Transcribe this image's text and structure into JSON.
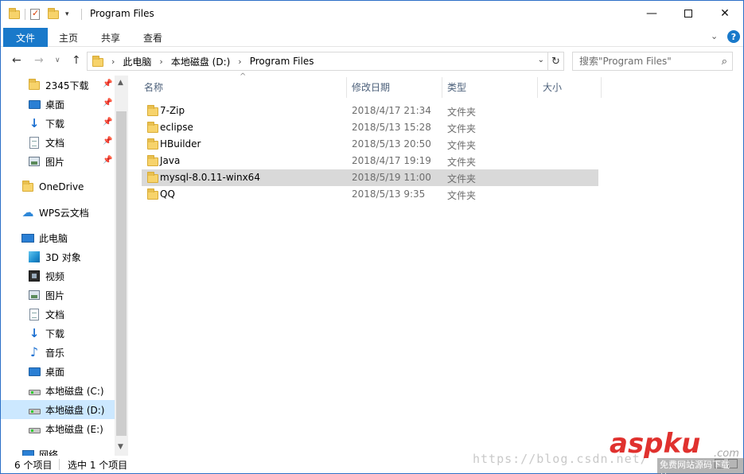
{
  "window": {
    "title": "Program Files",
    "controls": {
      "minimize": "—",
      "maximize": "",
      "close": "✕"
    }
  },
  "ribbon": {
    "tabs": [
      "文件",
      "主页",
      "共享",
      "查看"
    ],
    "help": "?"
  },
  "address": {
    "crumbs": [
      "此电脑",
      "本地磁盘 (D:)",
      "Program Files"
    ],
    "search_placeholder": "搜索\"Program Files\""
  },
  "nav_pane": {
    "items": [
      {
        "label": "2345下载",
        "icon": "folder-icon",
        "pinned": true
      },
      {
        "label": "桌面",
        "icon": "desktop-icon",
        "pinned": true
      },
      {
        "label": "下载",
        "icon": "download-icon",
        "pinned": true
      },
      {
        "label": "文档",
        "icon": "document-icon",
        "pinned": true
      },
      {
        "label": "图片",
        "icon": "pictures-icon",
        "pinned": true
      },
      {
        "label": "OneDrive",
        "icon": "folder-icon"
      },
      {
        "label": "WPS云文档",
        "icon": "cloud-icon"
      },
      {
        "label": "此电脑",
        "icon": "computer-icon"
      },
      {
        "label": "3D 对象",
        "icon": "3d-objects-icon"
      },
      {
        "label": "视频",
        "icon": "videos-icon"
      },
      {
        "label": "图片",
        "icon": "pictures-icon"
      },
      {
        "label": "文档",
        "icon": "document-icon"
      },
      {
        "label": "下载",
        "icon": "download-icon"
      },
      {
        "label": "音乐",
        "icon": "music-icon"
      },
      {
        "label": "桌面",
        "icon": "desktop-icon"
      },
      {
        "label": "本地磁盘 (C:)",
        "icon": "drive-icon"
      },
      {
        "label": "本地磁盘 (D:)",
        "icon": "drive-icon",
        "selected": true
      },
      {
        "label": "本地磁盘 (E:)",
        "icon": "drive-icon"
      },
      {
        "label": "网络",
        "icon": "network-icon"
      }
    ]
  },
  "file_list": {
    "columns": [
      "名称",
      "修改日期",
      "类型",
      "大小"
    ],
    "rows": [
      {
        "name": "7-Zip",
        "date": "2018/4/17 21:34",
        "type": "文件夹"
      },
      {
        "name": "eclipse",
        "date": "2018/5/13 15:28",
        "type": "文件夹"
      },
      {
        "name": "HBuilder",
        "date": "2018/5/13 20:50",
        "type": "文件夹"
      },
      {
        "name": "Java",
        "date": "2018/4/17 19:19",
        "type": "文件夹"
      },
      {
        "name": "mysql-8.0.11-winx64",
        "date": "2018/5/19 11:00",
        "type": "文件夹",
        "selected": true
      },
      {
        "name": "QQ",
        "date": "2018/5/13 9:35",
        "type": "文件夹"
      }
    ]
  },
  "status": {
    "count": "6 个项目",
    "selection": "选中 1 个项目"
  },
  "overlay": {
    "watermark_url": "https://blog.csdn.net/",
    "brand": "aspku",
    "brand_com": ".com",
    "brand_sub": "免费网站源码下载站!"
  }
}
